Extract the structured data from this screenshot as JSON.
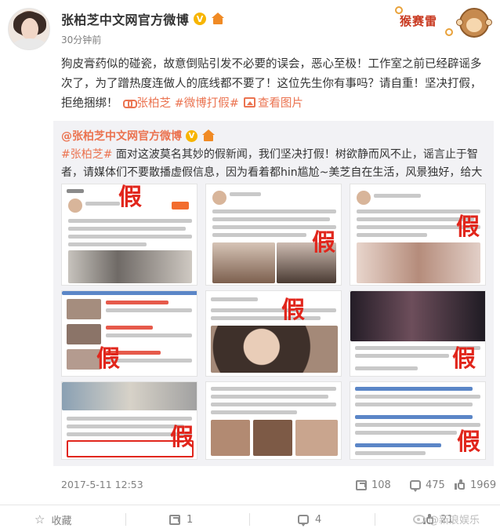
{
  "post": {
    "author": "张柏芝中文网官方微博",
    "time": "30分钟前",
    "text_main": "狗皮膏药似的碰瓷，故意倒贴引发不必要的误会，恶心至极！工作室之前已经辟谣多次了，为了蹭热度连做人的底线都不要了！这位先生你有事吗？请自重！坚决打假，拒绝捆绑！",
    "link_label": "张柏芝",
    "topic_label": "#微博打假#",
    "view_images_label": "查看图片"
  },
  "decoration": {
    "text": "猴赛雷"
  },
  "repost": {
    "author": "@张柏芝中文网官方微博",
    "topic": "#张柏芝#",
    "text": " 面对这波莫名其妙的假新闻，我们坚决打假！树欲静而风不止，谣言止于智者，请媒体们不要散播虚假信息，因为看着都hin尴尬~美芝自在生活，风景独好，给大家比心",
    "rose": "🌹"
  },
  "images": {
    "stamp": "假"
  },
  "footer": {
    "date": "2017-5-11 12:53",
    "shares": "108",
    "comments": "475",
    "likes": "1969"
  },
  "actions": {
    "favorite_label": "收藏",
    "repost_count": "1",
    "comment_count": "4",
    "like_count": "21",
    "watermark": "@新浪娱乐"
  },
  "colors": {
    "accent": "#eb7350",
    "verified": "#f7b500",
    "stamp_red": "#e1261c",
    "repost_bg": "#f2f2f5"
  }
}
